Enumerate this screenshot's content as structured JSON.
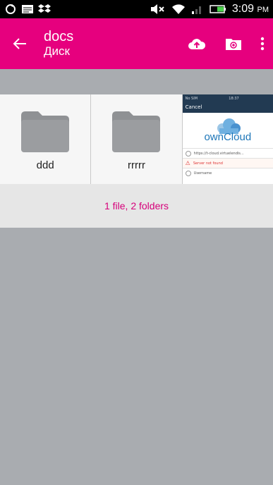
{
  "status_bar": {
    "time": "3:09",
    "ampm": "PM"
  },
  "app_bar": {
    "title": "docs",
    "subtitle": "Диск",
    "icons": [
      "arrow-left-icon",
      "cloud-upload-icon",
      "folder-plus-icon",
      "more-vert-icon"
    ]
  },
  "colors": {
    "accent": "#e6007e",
    "summary_text": "#d6007a"
  },
  "items": [
    {
      "type": "folder",
      "name": "ddd"
    },
    {
      "type": "folder",
      "name": "rrrrr"
    },
    {
      "type": "file",
      "name": ""
    }
  ],
  "preview": {
    "status": "No SIM",
    "clock": "18:37",
    "cancel": "Cancel",
    "logo_text": "ownCloud",
    "server_url": "https://t-cloud.virtuelendis...",
    "warning": "Server not found",
    "username_placeholder": "Username"
  },
  "summary": "1 file, 2 folders"
}
